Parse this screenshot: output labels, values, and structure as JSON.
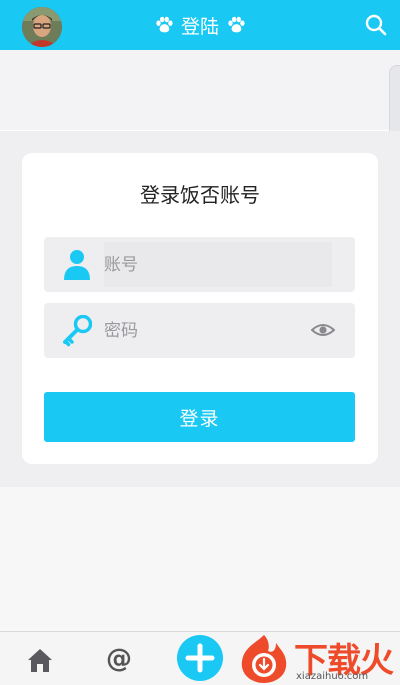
{
  "header": {
    "title": "登陆",
    "avatar_icon": "user-avatar-photo",
    "left_title_icon": "paw-icon",
    "right_title_icon": "paw-icon",
    "search_icon": "search-icon"
  },
  "login_card": {
    "title": "登录饭否账号",
    "account_field": {
      "placeholder": "账号",
      "value": "",
      "icon": "person-icon"
    },
    "password_field": {
      "placeholder": "密码",
      "value": "",
      "icon": "key-icon",
      "toggle_icon": "eye-icon"
    },
    "submit_label": "登录"
  },
  "bottom_nav": {
    "items": [
      {
        "icon": "home-icon"
      },
      {
        "label": "@",
        "icon": "mention-icon"
      },
      {
        "icon": "plus-icon"
      }
    ]
  },
  "watermark": {
    "text": "下载火",
    "url": "xiazaihuo.com"
  },
  "colors": {
    "accent": "#19c9f3",
    "background": "#efeff2",
    "card": "#ffffff",
    "field": "#eeeef1",
    "watermark": "#ee4b2b"
  }
}
